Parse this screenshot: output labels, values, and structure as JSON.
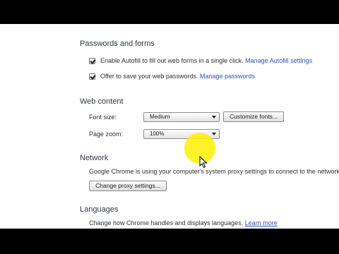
{
  "passwords_forms": {
    "title": "Passwords and forms",
    "autofill_text": "Enable Autofill to fill out web forms in a single click.",
    "autofill_link": "Manage Autofill settings",
    "autofill_checked": true,
    "save_passwords_text": "Offer to save your web passwords.",
    "save_passwords_link": "Manage passwords",
    "save_passwords_checked": true
  },
  "web_content": {
    "title": "Web content",
    "font_size_label": "Font size:",
    "font_size_value": "Medium",
    "customize_fonts_label": "Customize fonts...",
    "page_zoom_label": "Page zoom:",
    "page_zoom_value": "100%"
  },
  "network": {
    "title": "Network",
    "description": "Google Chrome is using your computer's system proxy settings to connect to the network",
    "proxy_button_label": "Change proxy settings..."
  },
  "languages": {
    "title": "Languages",
    "description": "Change how Chrome handles and displays languages.",
    "learn_more_link": "Learn more"
  },
  "colors": {
    "highlight": "#fff000",
    "link": "#3550b5",
    "section_title": "#303942"
  },
  "icons": {
    "cursor": "mouse-pointer-icon",
    "checkbox": "checkmark-icon"
  }
}
